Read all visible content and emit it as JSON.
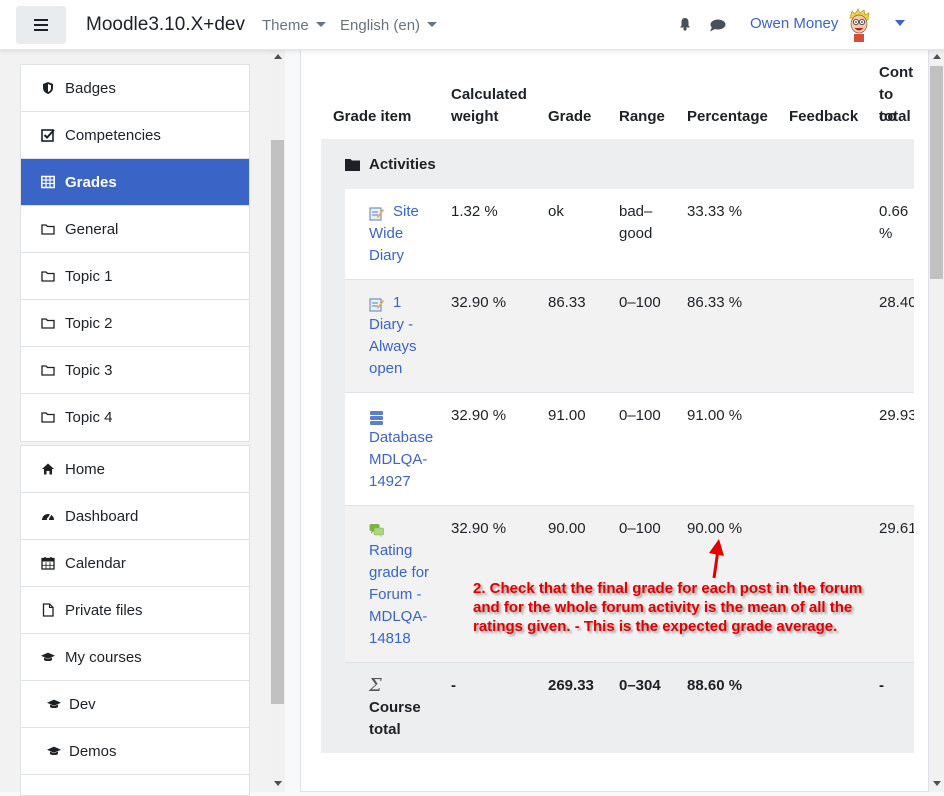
{
  "navbar": {
    "site_name": "Moodle3.10.X+dev",
    "theme_menu": "Theme",
    "language_menu": "English (en)",
    "user_name": "Owen Money"
  },
  "drawer": {
    "course_items": [
      {
        "label": "Badges",
        "icon": "shield-icon"
      },
      {
        "label": "Competencies",
        "icon": "checkbox-icon"
      },
      {
        "label": "Grades",
        "icon": "table-icon",
        "active": true
      },
      {
        "label": "General",
        "icon": "folder-icon"
      },
      {
        "label": "Topic 1",
        "icon": "folder-icon"
      },
      {
        "label": "Topic 2",
        "icon": "folder-icon"
      },
      {
        "label": "Topic 3",
        "icon": "folder-icon"
      },
      {
        "label": "Topic 4",
        "icon": "folder-icon"
      }
    ],
    "site_items": [
      {
        "label": "Home",
        "icon": "home-icon"
      },
      {
        "label": "Dashboard",
        "icon": "dashboard-icon"
      },
      {
        "label": "Calendar",
        "icon": "calendar-icon"
      },
      {
        "label": "Private files",
        "icon": "file-icon"
      },
      {
        "label": "My courses",
        "icon": "graduation-cap-icon"
      },
      {
        "label": "Dev",
        "icon": "graduation-cap-icon"
      },
      {
        "label": "Demos",
        "icon": "graduation-cap-icon"
      }
    ]
  },
  "grades_table": {
    "headers": {
      "grade_item": "Grade item",
      "calc_weight_1": "Calculated",
      "calc_weight_2": "weight",
      "grade": "Grade",
      "range": "Range",
      "percentage": "Percentage",
      "feedback": "Feedback",
      "contrib_1": "Cont",
      "contrib_2": "to co",
      "contrib_3": "total"
    },
    "category": "Activities",
    "rows": [
      {
        "item_lines": [
          "Site",
          "Wide",
          "Diary"
        ],
        "icon": "diary-icon",
        "weight": "1.32 %",
        "grade": "ok",
        "range_lines": [
          "bad–",
          "good"
        ],
        "percentage": "33.33 %",
        "feedback": "",
        "contribution": "0.66 %"
      },
      {
        "item_lines": [
          "1",
          "Diary -",
          "Always",
          "open"
        ],
        "icon": "diary-icon",
        "weight": "32.90 %",
        "grade": "86.33",
        "range_lines": [
          "0–100"
        ],
        "percentage": "86.33 %",
        "feedback": "",
        "contribution": "28.40"
      },
      {
        "item_lines": [
          "Database",
          "MDLQA-",
          "14927"
        ],
        "icon": "database-icon",
        "weight": "32.90 %",
        "grade": "91.00",
        "range_lines": [
          "0–100"
        ],
        "percentage": "91.00 %",
        "feedback": "",
        "contribution": "29.93"
      },
      {
        "item_lines": [
          "Rating",
          "grade for",
          "Forum -",
          "MDLQA-",
          "14818"
        ],
        "icon": "forum-icon",
        "weight": "32.90 %",
        "grade": "90.00",
        "range_lines": [
          "0–100"
        ],
        "percentage": "90.00 %",
        "feedback": "",
        "contribution": "29.61"
      }
    ],
    "total": {
      "sigma": "Σ",
      "label_lines": [
        "Course",
        "total"
      ],
      "weight": "-",
      "grade": "269.33",
      "range": "0–304",
      "percentage": "88.60 %",
      "contribution": "-"
    }
  },
  "annotation": {
    "text": "2. Check that the final grade for each post in the forum and for the whole forum activity is the mean of all the ratings given. - This is the expected grade average.",
    "color": "#e00000"
  },
  "colors": {
    "accent": "#3a65c7",
    "link": "#3a65c7"
  }
}
